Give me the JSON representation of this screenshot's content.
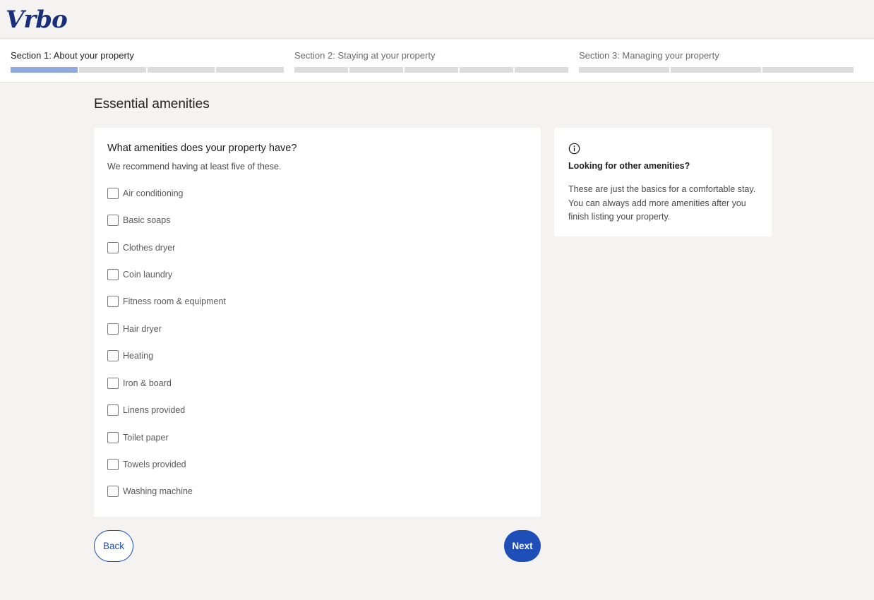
{
  "header": {
    "logo_text": "Vrbo"
  },
  "progress": {
    "sections": [
      {
        "label": "Section 1: About your property",
        "active": true,
        "steps_total": 4,
        "steps_completed": 1
      },
      {
        "label": "Section 2: Staying at your property",
        "active": false,
        "steps_total": 5,
        "steps_completed": 0
      },
      {
        "label": "Section 3: Managing your property",
        "active": false,
        "steps_total": 3,
        "steps_completed": 0
      }
    ]
  },
  "main": {
    "title": "Essential amenities",
    "question": "What amenities does your property have?",
    "hint": "We recommend having at least five of these.",
    "amenities": [
      {
        "label": "Air conditioning",
        "checked": false
      },
      {
        "label": "Basic soaps",
        "checked": false
      },
      {
        "label": "Clothes dryer",
        "checked": false
      },
      {
        "label": "Coin laundry",
        "checked": false
      },
      {
        "label": "Fitness room & equipment",
        "checked": false
      },
      {
        "label": "Hair dryer",
        "checked": false
      },
      {
        "label": "Heating",
        "checked": false
      },
      {
        "label": "Iron & board",
        "checked": false
      },
      {
        "label": "Linens provided",
        "checked": false
      },
      {
        "label": "Toilet paper",
        "checked": false
      },
      {
        "label": "Towels provided",
        "checked": false
      },
      {
        "label": "Washing machine",
        "checked": false
      }
    ]
  },
  "info": {
    "icon": "info-icon",
    "title": "Looking for other amenities?",
    "text": "These are just the basics for a comfortable stay. You can always add more amenities after you finish listing your property."
  },
  "actions": {
    "back_label": "Back",
    "next_label": "Next"
  },
  "colors": {
    "brand": "#1a2f7c",
    "primary_button": "#1e4eb8",
    "progress_filled": "#8fa8de",
    "progress_empty": "#dcdcdc",
    "page_background": "#f4f3f1"
  }
}
